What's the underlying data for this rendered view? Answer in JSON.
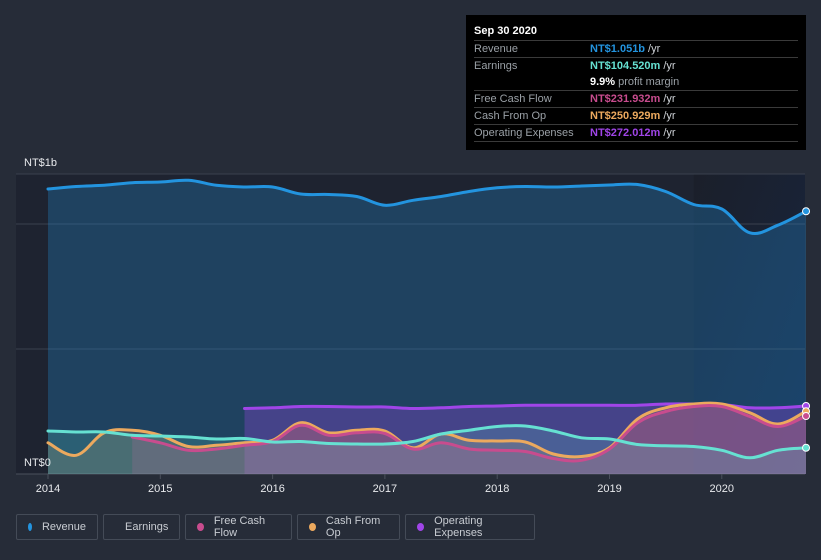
{
  "tooltip": {
    "date": "Sep 30 2020",
    "rows": [
      {
        "label": "Revenue",
        "value": "NT$1.051b",
        "unit": "/yr",
        "color": "#2394df"
      },
      {
        "label": "Earnings",
        "value": "NT$104.520m",
        "unit": "/yr",
        "color": "#66e1d2"
      },
      {
        "label": "Free Cash Flow",
        "value": "NT$231.932m",
        "unit": "/yr",
        "color": "#c84c8e"
      },
      {
        "label": "Cash From Op",
        "value": "NT$250.929m",
        "unit": "/yr",
        "color": "#eca95e"
      },
      {
        "label": "Operating Expenses",
        "value": "NT$272.012m",
        "unit": "/yr",
        "color": "#a045e8"
      }
    ],
    "margin_value": "9.9%",
    "margin_label": "profit margin"
  },
  "legend": [
    {
      "label": "Revenue",
      "color": "#2394df"
    },
    {
      "label": "Earnings",
      "color": "#66e1d2"
    },
    {
      "label": "Free Cash Flow",
      "color": "#c84c8e"
    },
    {
      "label": "Cash From Op",
      "color": "#eca95e"
    },
    {
      "label": "Operating Expenses",
      "color": "#a045e8"
    }
  ],
  "chart_data": {
    "type": "area",
    "title": "",
    "xlabel": "",
    "ylabel": "",
    "x_ticks": [
      "2014",
      "2015",
      "2016",
      "2017",
      "2018",
      "2019",
      "2020"
    ],
    "y_tick_labels": [
      {
        "value": 1.0,
        "label": "NT$1b"
      },
      {
        "value": 0,
        "label": "NT$0"
      }
    ],
    "ylim": [
      0,
      1.2
    ],
    "xlim": [
      2013.75,
      2020.75
    ],
    "units": "NT$ billions per year",
    "gridlines": [
      0,
      0.5,
      1.0,
      1.2
    ],
    "forecast_shade_start": 2019.75,
    "series": [
      {
        "name": "Revenue",
        "color": "#2394df",
        "x": [
          2014.0,
          2014.25,
          2014.5,
          2014.75,
          2015.0,
          2015.25,
          2015.5,
          2015.75,
          2016.0,
          2016.25,
          2016.5,
          2016.75,
          2017.0,
          2017.25,
          2017.5,
          2017.75,
          2018.0,
          2018.25,
          2018.5,
          2018.75,
          2019.0,
          2019.25,
          2019.5,
          2019.75,
          2020.0,
          2020.25,
          2020.5,
          2020.75
        ],
        "values": [
          1.14,
          1.15,
          1.155,
          1.165,
          1.168,
          1.175,
          1.155,
          1.148,
          1.148,
          1.12,
          1.118,
          1.11,
          1.075,
          1.095,
          1.11,
          1.13,
          1.145,
          1.15,
          1.148,
          1.152,
          1.156,
          1.158,
          1.13,
          1.078,
          1.06,
          0.965,
          0.995,
          1.051
        ]
      },
      {
        "name": "Earnings",
        "color": "#66e1d2",
        "x": [
          2014.0,
          2014.25,
          2014.5,
          2014.75,
          2015.0,
          2015.25,
          2015.5,
          2015.75,
          2016.0,
          2016.25,
          2016.5,
          2016.75,
          2017.0,
          2017.25,
          2017.5,
          2017.75,
          2018.0,
          2018.25,
          2018.5,
          2018.75,
          2019.0,
          2019.25,
          2019.5,
          2019.75,
          2020.0,
          2020.25,
          2020.5,
          2020.75
        ],
        "values": [
          0.172,
          0.168,
          0.168,
          0.155,
          0.152,
          0.148,
          0.14,
          0.142,
          0.128,
          0.13,
          0.122,
          0.12,
          0.12,
          0.13,
          0.16,
          0.175,
          0.19,
          0.192,
          0.172,
          0.145,
          0.14,
          0.118,
          0.113,
          0.11,
          0.095,
          0.065,
          0.095,
          0.105
        ]
      },
      {
        "name": "Free Cash Flow",
        "color": "#c84c8e",
        "x": [
          2014.75,
          2015.0,
          2015.25,
          2015.5,
          2015.75,
          2016.0,
          2016.25,
          2016.5,
          2016.75,
          2017.0,
          2017.25,
          2017.5,
          2017.75,
          2018.0,
          2018.25,
          2018.5,
          2018.75,
          2019.0,
          2019.25,
          2019.5,
          2019.75,
          2020.0,
          2020.25,
          2020.5,
          2020.75
        ],
        "values": [
          0.148,
          0.125,
          0.095,
          0.1,
          0.115,
          0.13,
          0.195,
          0.155,
          0.165,
          0.162,
          0.1,
          0.125,
          0.1,
          0.095,
          0.09,
          0.062,
          0.055,
          0.1,
          0.205,
          0.25,
          0.27,
          0.27,
          0.23,
          0.19,
          0.232
        ]
      },
      {
        "name": "Cash From Op",
        "color": "#eca95e",
        "x": [
          2014.0,
          2014.25,
          2014.5,
          2014.75,
          2015.0,
          2015.25,
          2015.5,
          2015.75,
          2016.0,
          2016.25,
          2016.5,
          2016.75,
          2017.0,
          2017.25,
          2017.5,
          2017.75,
          2018.0,
          2018.25,
          2018.5,
          2018.75,
          2019.0,
          2019.25,
          2019.5,
          2019.75,
          2020.0,
          2020.25,
          2020.5,
          2020.75
        ],
        "values": [
          0.125,
          0.075,
          0.165,
          0.175,
          0.155,
          0.11,
          0.115,
          0.125,
          0.135,
          0.205,
          0.165,
          0.175,
          0.172,
          0.105,
          0.16,
          0.135,
          0.132,
          0.128,
          0.08,
          0.07,
          0.105,
          0.22,
          0.265,
          0.28,
          0.28,
          0.245,
          0.2,
          0.251
        ]
      },
      {
        "name": "Operating Expenses",
        "color": "#a045e8",
        "x": [
          2015.75,
          2016.0,
          2016.25,
          2016.5,
          2016.75,
          2017.0,
          2017.25,
          2017.5,
          2017.75,
          2018.0,
          2018.25,
          2018.5,
          2018.75,
          2019.0,
          2019.25,
          2019.5,
          2019.75,
          2020.0,
          2020.25,
          2020.5,
          2020.75
        ],
        "values": [
          0.262,
          0.265,
          0.27,
          0.27,
          0.268,
          0.268,
          0.262,
          0.265,
          0.27,
          0.272,
          0.275,
          0.275,
          0.275,
          0.275,
          0.275,
          0.28,
          0.28,
          0.278,
          0.265,
          0.265,
          0.272
        ]
      }
    ]
  }
}
